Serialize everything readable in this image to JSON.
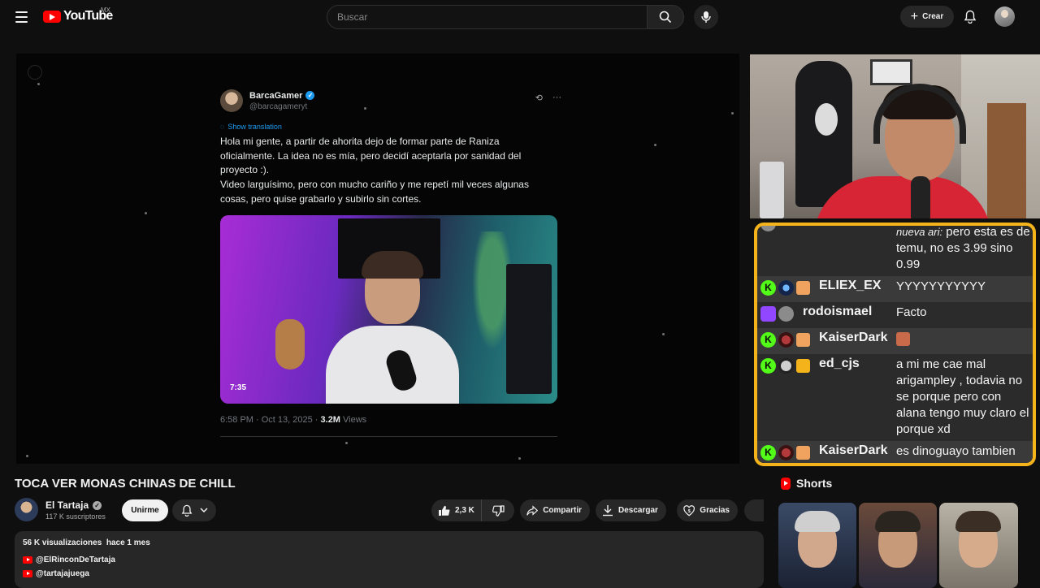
{
  "header": {
    "logo_text": "YouTube",
    "country_code": "MX",
    "search_placeholder": "Buscar",
    "create_label": "Crear"
  },
  "tweet": {
    "author_name": "BarcaGamer",
    "author_handle": "@barcagameryt",
    "show_translation": "Show translation",
    "text": "Hola mi gente, a partir de ahorita dejo de formar parte de Raniza\noficialmente. La idea no es mía, pero decidí aceptarla por sanidad del\nproyecto :).\nVideo larguísimo, pero con mucho cariño y me repetí mil veces algunas\ncosas, pero quise grabarlo y subirlo sin cortes.",
    "media_duration": "7:35",
    "timestamp": "6:58 PM · Oct 13, 2025 · ",
    "views_count": "3.2M",
    "views_label": " Views"
  },
  "chat": {
    "messages": [
      {
        "prefix": "nueva ari:",
        "text": "pero esta es de temu, no es 3.99 sino 0.99"
      },
      {
        "user": "ELIEX_EX",
        "text": "YYYYYYYYYYY"
      },
      {
        "user": "rodoismael",
        "text": "Facto"
      },
      {
        "user": "KaiserDark",
        "text": ""
      },
      {
        "user": "ed_cjs",
        "text": "a mi me cae mal arigampley , todavia no se porque pero con alana tengo muy claro el porque xd"
      },
      {
        "user": "KaiserDark",
        "text": "es dinoguayo tambien"
      }
    ]
  },
  "video": {
    "title": "TOCA VER MONAS CHINAS DE CHILL",
    "channel_name": "El Tartaja",
    "subscribers": "117 K suscriptores",
    "join_label": "Unirme",
    "likes": "2,3 K",
    "share_label": "Compartir",
    "download_label": "Descargar",
    "thanks_label": "Gracias"
  },
  "description": {
    "views": "56 K visualizaciones",
    "age": "hace 1 mes",
    "links": [
      "@ElRinconDeTartaja",
      "@tartajajuega"
    ]
  },
  "shorts": {
    "title": "Shorts"
  },
  "colors": {
    "accent_red": "#ff0000",
    "chat_border": "#f4b21b",
    "kick_green": "#53fc18",
    "twitch_purple": "#9146ff"
  }
}
